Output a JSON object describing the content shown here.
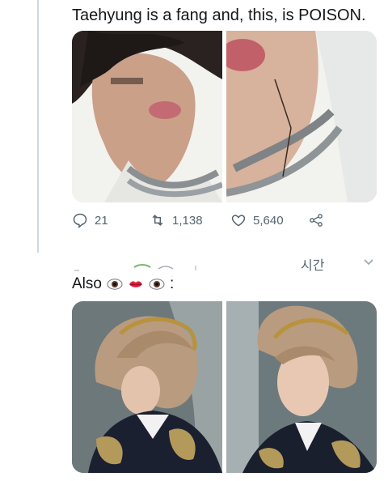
{
  "tweet": {
    "text": "Taehyung is a fang and, this, is POISON.",
    "stats": {
      "replies": "21",
      "retweets": "1,138",
      "likes": "5,640"
    }
  },
  "header": {
    "time_label": "시간"
  },
  "reply": {
    "text_before": "Also",
    "text_after": ":",
    "emojis": [
      "eye-emoji",
      "lips-emoji",
      "eye-emoji"
    ]
  },
  "icons": [
    "reply-icon",
    "retweet-icon",
    "like-icon",
    "share-icon",
    "chevron-down-icon"
  ],
  "colors": {
    "icon_gray": "#536471",
    "thread_line": "#cfd9de",
    "text": "#14171a"
  }
}
